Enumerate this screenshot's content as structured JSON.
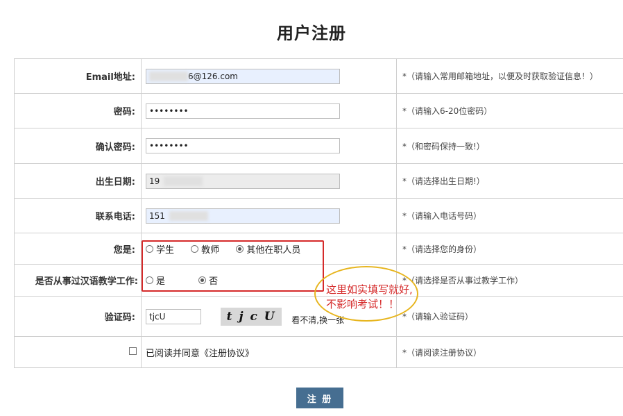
{
  "page": {
    "title": "用户注册"
  },
  "fields": {
    "email": {
      "label": "Email地址:",
      "value": "6@126.com",
      "hint": "*（请输入常用邮箱地址，以便及时获取验证信息！）"
    },
    "password": {
      "label": "密码:",
      "value": "••••••••",
      "hint": "*（请输入6-20位密码）"
    },
    "confirm": {
      "label": "确认密码:",
      "value": "••••••••",
      "hint": "*（和密码保持一致!）"
    },
    "birthday": {
      "label": "出生日期:",
      "value": "19",
      "hint": "*（请选择出生日期!）"
    },
    "phone": {
      "label": "联系电话:",
      "value": "151",
      "hint": "*（请输入电话号码）"
    },
    "identity": {
      "label": "您是:",
      "options": [
        {
          "label": "学生",
          "checked": false
        },
        {
          "label": "教师",
          "checked": false
        },
        {
          "label": "其他在职人员",
          "checked": true
        }
      ],
      "hint": "*（请选择您的身份）"
    },
    "teaching": {
      "label": "是否从事过汉语教学工作:",
      "options": [
        {
          "label": "是",
          "checked": false
        },
        {
          "label": "否",
          "checked": true
        }
      ],
      "hint": "*（请选择是否从事过教学工作）"
    },
    "captcha": {
      "label": "验证码:",
      "value": "tjcU",
      "image_text": "t j c U",
      "refresh": "看不清,换一张",
      "hint": "*（请输入验证码）"
    },
    "agreement": {
      "text": "已阅读并同意《注册协议》",
      "hint": "*（请阅读注册协议）"
    }
  },
  "annotation": {
    "line1": "这里如实填写就好,",
    "line2": "不影响考试！！"
  },
  "submit_label": "注 册",
  "colors": {
    "submit": "#466e91",
    "annotation_red": "#d52a2a",
    "bubble": "#e7b51e"
  }
}
